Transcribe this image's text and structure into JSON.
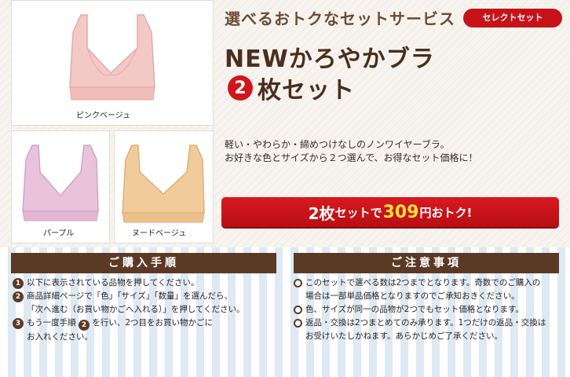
{
  "header": {
    "service_title": "選べるおトクなセットサービス",
    "badge": "セレクトセット",
    "title_line1": "NEWかろやかブラ",
    "title_number": "2",
    "title_line2": "枚セット"
  },
  "products": [
    {
      "caption": "ピンクベージュ",
      "color": "#f3c9c6"
    },
    {
      "caption": "パープル",
      "color": "#e9c3dc"
    },
    {
      "caption": "ヌードベージュ",
      "color": "#f1cc9a"
    }
  ],
  "description": {
    "line1": "軽い・やわらか・締めつけなしのノンワイヤーブラ。",
    "line2": "お好きな色とサイズから２つ選んで、お得なセット価格に！"
  },
  "offer": {
    "part1": "2枚",
    "part2": "セットで",
    "price": "309",
    "part3": "円おトク!"
  },
  "purchase": {
    "heading": "ご購入手順",
    "steps": [
      {
        "num": "1",
        "lines": [
          "以下に表示されている品物を押してください。"
        ]
      },
      {
        "num": "2",
        "lines": [
          "商品詳細ページで「色」「サイズ」「数量」を選んだら、",
          "「次へ進む（お買い物かごへ入れる）」を押してください。"
        ]
      },
      {
        "num": "3",
        "pre": "もう一度手順",
        "inline_num": "2",
        "post": "を行い、2つ目をお買い物かごに",
        "line2": "お入れください。"
      }
    ]
  },
  "notes": {
    "heading": "ご注意事項",
    "items": [
      {
        "lines": [
          "このセットで選べる数は2つまでとなります。奇数でのご購入の",
          "場合は一部単品価格となりますのでご承知おきください。"
        ]
      },
      {
        "lines": [
          "色、サイズが同一の品物が2つでもセット価格となります。"
        ]
      },
      {
        "lines": [
          "返品・交換は2つまとめてのみ承ります。1つだけの返品・交換は",
          "お受けいたしかねます。あらかじめご了承ください。"
        ]
      }
    ]
  },
  "colors": {
    "accent_red": "#d0161c",
    "brown": "#5b3a25",
    "price_yellow": "#ffe03a"
  }
}
